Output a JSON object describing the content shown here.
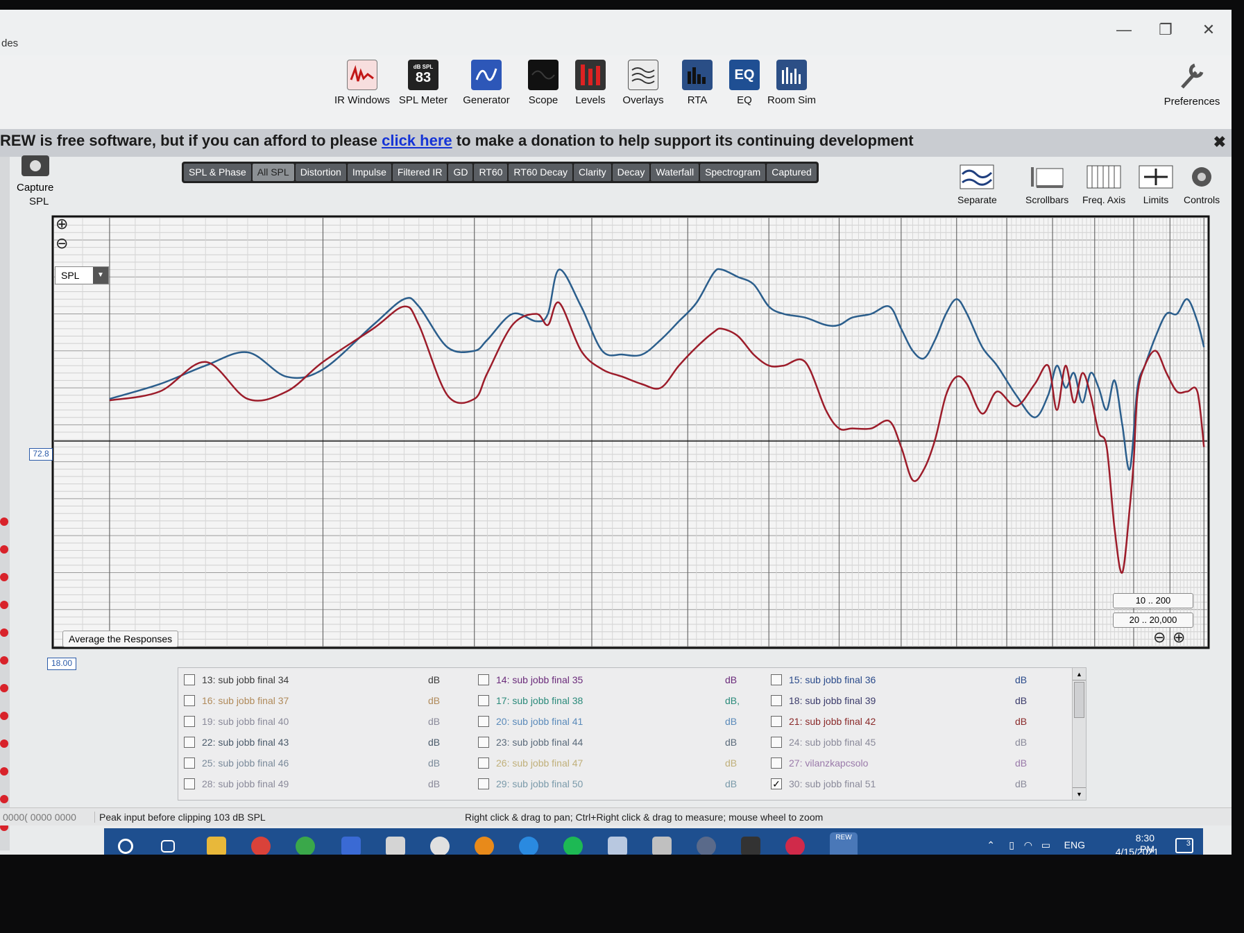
{
  "window": {
    "title": "des",
    "controls": [
      "—",
      "❐",
      "✕"
    ]
  },
  "toolbar": {
    "tools": [
      {
        "label": "IR Windows",
        "icon": "ir-windows-icon",
        "text": ""
      },
      {
        "label": "SPL Meter",
        "icon": "spl-meter-icon",
        "text": "83",
        "badge": "dB SPL"
      },
      {
        "label": "Generator",
        "icon": "generator-icon",
        "text": ""
      },
      {
        "label": "Scope",
        "icon": "scope-icon",
        "text": ""
      },
      {
        "label": "Levels",
        "icon": "levels-icon",
        "text": ""
      },
      {
        "label": "Overlays",
        "icon": "overlays-icon",
        "text": ""
      },
      {
        "label": "RTA",
        "icon": "rta-icon",
        "text": ""
      },
      {
        "label": "EQ",
        "icon": "eq-icon",
        "text": "EQ"
      },
      {
        "label": "Room Sim",
        "icon": "room-sim-icon",
        "text": ""
      }
    ],
    "preferences_label": "Preferences"
  },
  "donate": {
    "prefix": "REW is free software, but if you can afford to please ",
    "link": "click here",
    "suffix": " to make a donation to help support its continuing development",
    "close": "✖"
  },
  "capture_label": "Capture",
  "tabs": [
    "SPL & Phase",
    "All SPL",
    "Distortion",
    "Impulse",
    "Filtered IR",
    "GD",
    "RT60",
    "RT60 Decay",
    "Clarity",
    "Decay",
    "Waterfall",
    "Spectrogram",
    "Captured"
  ],
  "active_tab": "All SPL",
  "right_tools": [
    {
      "label": "Separate",
      "icon": "separate-icon"
    },
    {
      "label": "Scrollbars",
      "icon": "scrollbars-icon"
    },
    {
      "label": "Freq. Axis",
      "icon": "freq-axis-icon"
    },
    {
      "label": "Limits",
      "icon": "limits-icon"
    },
    {
      "label": "Controls",
      "icon": "controls-icon"
    }
  ],
  "plot": {
    "y_axis_label": "SPL",
    "spl_select": "SPL",
    "cursor_level": "72.8",
    "x_start_box": "18.00",
    "average_button": "Average the Responses",
    "range_buttons": [
      "10 .. 200",
      "20 .. 20,000"
    ],
    "zoom_in": "⊕",
    "zoom_out": "⊖"
  },
  "chart_data": {
    "type": "line",
    "xscale": "log",
    "xlim": [
      18,
      161
    ],
    "ylim": [
      45,
      103
    ],
    "x_ticks": [
      "20",
      "30",
      "40",
      "50",
      "60",
      "70",
      "80",
      "90",
      "100",
      "110",
      "120",
      "130",
      "140",
      "150",
      "161Hz"
    ],
    "y_ticks": [
      "45",
      "50",
      "55",
      "60",
      "65",
      "70",
      "75",
      "80",
      "85",
      "90",
      "95",
      "100"
    ],
    "grid": true,
    "cursor_y": 72.8,
    "series": [
      {
        "color": "#2b5e8c",
        "x": [
          20,
          22,
          24,
          26,
          28,
          30,
          33,
          35,
          36,
          38,
          40,
          41,
          43,
          45,
          46,
          47,
          49,
          51,
          53,
          55,
          57,
          59,
          61,
          63,
          64,
          66,
          68,
          70,
          72,
          75,
          78,
          80,
          82,
          85,
          88,
          90,
          92,
          94,
          96,
          98,
          100,
          102,
          105,
          108,
          112,
          116,
          119,
          121,
          123,
          125,
          127,
          129,
          131,
          133,
          135,
          137,
          139,
          141,
          143,
          146,
          149,
          152,
          155,
          158,
          160
        ],
        "values": [
          78.5,
          80.5,
          83,
          84.8,
          81.5,
          82.5,
          88.5,
          92,
          91,
          85.5,
          85,
          86.5,
          90,
          89,
          90,
          96,
          91,
          85,
          84.5,
          84.5,
          86.5,
          89,
          91.5,
          95.5,
          96,
          95,
          94,
          91,
          90,
          89.5,
          88.5,
          88.5,
          89.5,
          90,
          91,
          88,
          85,
          84,
          86.5,
          90,
          92,
          90,
          85.5,
          83,
          79,
          76,
          79,
          83,
          80,
          82,
          78,
          82,
          80,
          77,
          81,
          75,
          69,
          80,
          83,
          87,
          90,
          90,
          92,
          89,
          85.5
        ]
      },
      {
        "color": "#9c1c2a",
        "x": [
          20,
          22,
          24,
          26,
          28,
          30,
          33,
          35,
          36,
          38,
          40,
          41,
          43,
          45,
          46,
          47,
          49,
          51,
          53,
          55,
          57,
          59,
          61,
          63,
          64,
          66,
          68,
          70,
          72,
          75,
          78,
          80,
          82,
          85,
          88,
          90,
          92,
          94,
          96,
          98,
          100,
          102,
          105,
          108,
          112,
          116,
          119,
          121,
          123,
          125,
          127,
          129,
          131,
          133,
          135,
          137,
          139,
          140,
          141,
          143,
          146,
          149,
          152,
          155,
          158,
          160
        ],
        "values": [
          78.3,
          79.5,
          83.5,
          78.5,
          79.5,
          83.5,
          88,
          91,
          88.5,
          79,
          78.5,
          82,
          88.5,
          90,
          88.5,
          91.5,
          85,
          82.5,
          81.5,
          80.5,
          80,
          83,
          85.5,
          87.5,
          88,
          87,
          84.5,
          83,
          83,
          83.5,
          77,
          74.5,
          74.5,
          74.5,
          75.5,
          72,
          67.5,
          69,
          73,
          79,
          81.5,
          80.5,
          76.5,
          79.5,
          77.5,
          80.5,
          83,
          77,
          83,
          78,
          82,
          79,
          74,
          72,
          61,
          55,
          64,
          70,
          79,
          83,
          85,
          82,
          79.5,
          79.5,
          79.5,
          72
        ]
      }
    ]
  },
  "traces": [
    {
      "label": "13: sub jobb final 34",
      "unit": "dB",
      "checked": false,
      "color": "#3a3a3a"
    },
    {
      "label": "14: sub jobb final 35",
      "unit": "dB",
      "checked": false,
      "color": "#6a2a7a"
    },
    {
      "label": "15: sub jobb final 36",
      "unit": "dB",
      "checked": false,
      "color": "#2a4a8a"
    },
    {
      "label": "16: sub jobb final 37",
      "unit": "dB",
      "checked": false,
      "color": "#b08a5a"
    },
    {
      "label": "17: sub jobb final 38",
      "unit": "dB,",
      "checked": false,
      "color": "#2a8a7a"
    },
    {
      "label": "18: sub jobb final 39",
      "unit": "dB",
      "checked": false,
      "color": "#3a3a6a"
    },
    {
      "label": "19: sub jobb final 40",
      "unit": "dB",
      "checked": false,
      "color": "#8a8a9a"
    },
    {
      "label": "20: sub jobb final 41",
      "unit": "dB",
      "checked": false,
      "color": "#5a8aba"
    },
    {
      "label": "21: sub jobb final 42",
      "unit": "dB",
      "checked": false,
      "color": "#8a2a2a"
    },
    {
      "label": "22: sub jobb final 43",
      "unit": "dB",
      "checked": false,
      "color": "#4a5a6a"
    },
    {
      "label": "23: sub jobb final 44",
      "unit": "dB",
      "checked": false,
      "color": "#5a6a7a"
    },
    {
      "label": "24: sub jobb final 45",
      "unit": "dB",
      "checked": false,
      "color": "#8a8a9a"
    },
    {
      "label": "25: sub jobb final 46",
      "unit": "dB",
      "checked": false,
      "color": "#7a8a9a"
    },
    {
      "label": "26: sub jobb final 47",
      "unit": "dB",
      "checked": false,
      "color": "#c0b07a"
    },
    {
      "label": "27: vilanzkapcsolo",
      "unit": "dB",
      "checked": false,
      "color": "#9a7aaa"
    },
    {
      "label": "28: sub jobb final 49",
      "unit": "dB",
      "checked": false,
      "color": "#8a8a9a"
    },
    {
      "label": "29: sub jobb final 50",
      "unit": "dB",
      "checked": false,
      "color": "#7a9aaa"
    },
    {
      "label": "30: sub jobb final 51",
      "unit": "dB",
      "checked": true,
      "color": "#8a8a9a"
    }
  ],
  "status": {
    "left": "0000( 0000 0000",
    "peak": "Peak input before clipping 103 dB SPL",
    "hint": "Right click & drag to pan; Ctrl+Right click & drag to measure; mouse wheel to zoom"
  },
  "taskbar": {
    "language": "ENG",
    "time": "8:30 PM",
    "date": "4/15/2021",
    "notifications": "3",
    "rew_label": "REW"
  }
}
